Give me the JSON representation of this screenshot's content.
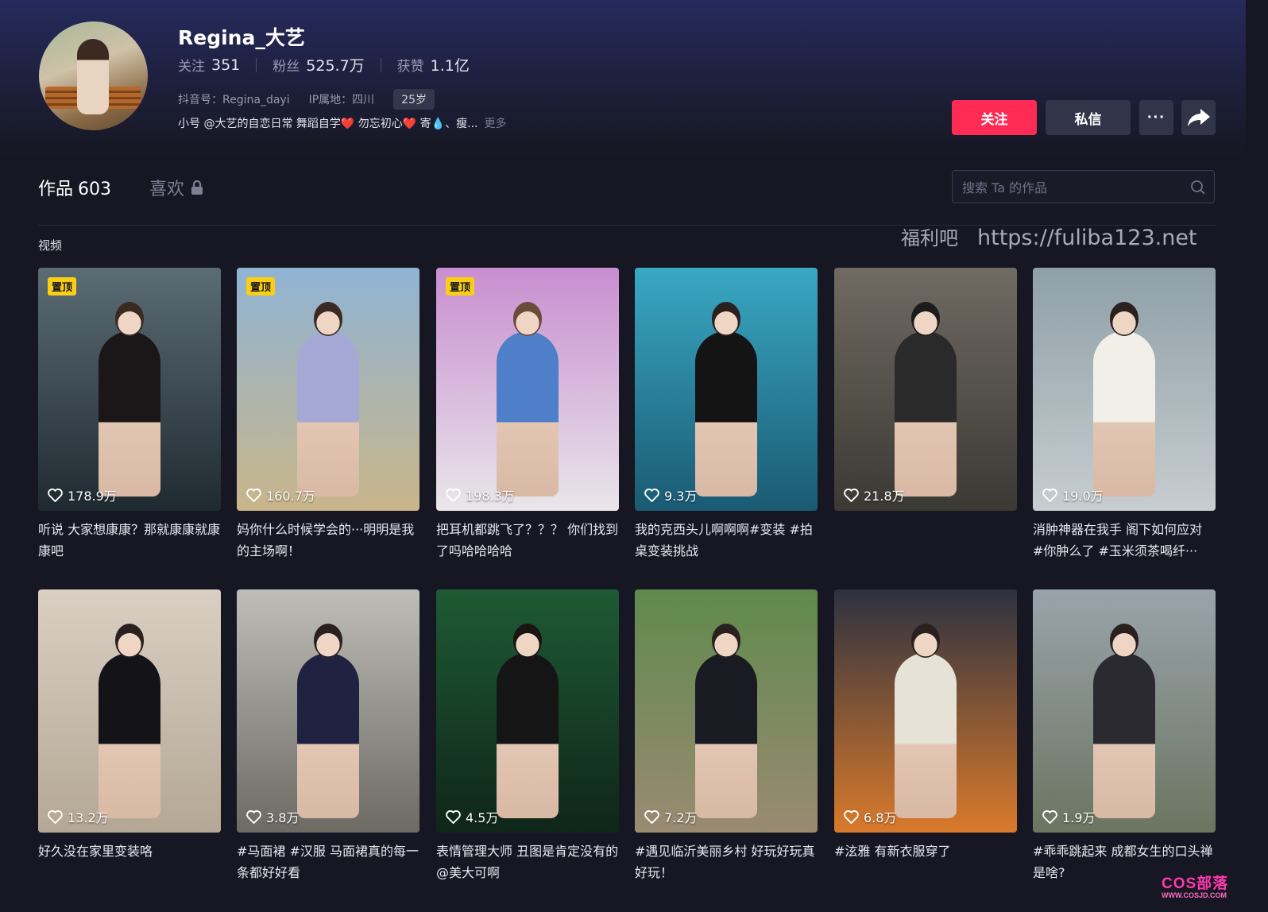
{
  "profile": {
    "username": "Regina_大艺",
    "stats": [
      {
        "label": "关注",
        "value": "351"
      },
      {
        "label": "粉丝",
        "value": "525.7万"
      },
      {
        "label": "获赞",
        "value": "1.1亿"
      }
    ],
    "douyin_id": "抖音号：Regina_dayi",
    "ip": "IP属地：四川",
    "age": "25岁",
    "bio": "小号 @大艺的自恋日常  舞蹈自学❤️ 勿忘初心❤️  寄💧、瘦...",
    "bio_more": "更多"
  },
  "actions": {
    "follow": "关注",
    "message": "私信",
    "more": "···"
  },
  "tabs": {
    "works_label": "作品",
    "works_count": "603",
    "likes_label": "喜欢"
  },
  "search": {
    "placeholder": "搜索 Ta 的作品"
  },
  "section": {
    "label": "视频"
  },
  "watermark": {
    "cn": "福利吧",
    "url": "https://fuliba123.net"
  },
  "corner_logo": {
    "main": "COS部落",
    "sub": "WWW.COSJD.COM"
  },
  "videos": [
    {
      "pinned": "置顶",
      "likes": "178.9万",
      "caption": "听说 大家想康康？那就康康就康康吧",
      "colors": [
        "#5b6c74",
        "#1f2a30"
      ]
    },
    {
      "pinned": "置顶",
      "likes": "160.7万",
      "caption": "妈你什么时候学会的···明明是我的主场啊！",
      "colors": [
        "#8fb4d4",
        "#c9b58a"
      ]
    },
    {
      "pinned": "置顶",
      "likes": "198.3万",
      "caption": "把耳机都跳飞了？？？ 你们找到了吗哈哈哈哈",
      "colors": [
        "#c98ed0",
        "#e9e6ea"
      ]
    },
    {
      "pinned": "",
      "likes": "9.3万",
      "caption": "我的克西头儿啊啊啊#变装 #拍桌变装挑战",
      "colors": [
        "#3aa8c4",
        "#1a5a73"
      ]
    },
    {
      "pinned": "",
      "likes": "21.8万",
      "caption": "",
      "colors": [
        "#6f6a62",
        "#3b3934"
      ]
    },
    {
      "pinned": "",
      "likes": "19.0万",
      "caption": "消肿神器在我手 阁下如何应对 #你肿么了 #玉米须茶喝纤···",
      "colors": [
        "#8fa0a8",
        "#c7cdd0"
      ]
    },
    {
      "pinned": "",
      "likes": "13.2万",
      "caption": "好久没在家里变装咯",
      "colors": [
        "#d9cfc2",
        "#b4a795"
      ]
    },
    {
      "pinned": "",
      "likes": "3.8万",
      "caption": "#马面裙 #汉服 马面裙真的每一条都好好看",
      "colors": [
        "#bfbdb8",
        "#6d6a64"
      ]
    },
    {
      "pinned": "",
      "likes": "4.5万",
      "caption": "表情管理大师 丑图是肯定没有的@美大可啊",
      "colors": [
        "#1e5a34",
        "#0f2519"
      ]
    },
    {
      "pinned": "",
      "likes": "7.2万",
      "caption": "#遇见临沂美丽乡村 好玩好玩真好玩！",
      "colors": [
        "#5f8a4c",
        "#9a8a72"
      ]
    },
    {
      "pinned": "",
      "likes": "6.8万",
      "caption": "#泫雅 有新衣服穿了",
      "colors": [
        "#2d3140",
        "#d97a2b"
      ]
    },
    {
      "pinned": "",
      "likes": "1.9万",
      "caption": "#乖乖跳起来 成都女生的口头禅是啥?",
      "colors": [
        "#9aa3ab",
        "#6b7560"
      ]
    }
  ],
  "figure_colors": [
    {
      "body": "#1b1718",
      "head": "#3a2a24"
    },
    {
      "body": "#a6a9d6",
      "head": "#3a2a24"
    },
    {
      "body": "#4f7fc9",
      "head": "#6b4a3a"
    },
    {
      "body": "#141414",
      "head": "#2b2020"
    },
    {
      "body": "#2a2a2a",
      "head": "#1c1c1c"
    },
    {
      "body": "#f1efe8",
      "head": "#2a2020"
    },
    {
      "body": "#141418",
      "head": "#2a2020"
    },
    {
      "body": "#1f2240",
      "head": "#2a2020"
    },
    {
      "body": "#151515",
      "head": "#1c1414"
    },
    {
      "body": "#1a1a22",
      "head": "#2a2020"
    },
    {
      "body": "#e6e2d6",
      "head": "#2a2020"
    },
    {
      "body": "#2a2a30",
      "head": "#2a2020"
    }
  ]
}
